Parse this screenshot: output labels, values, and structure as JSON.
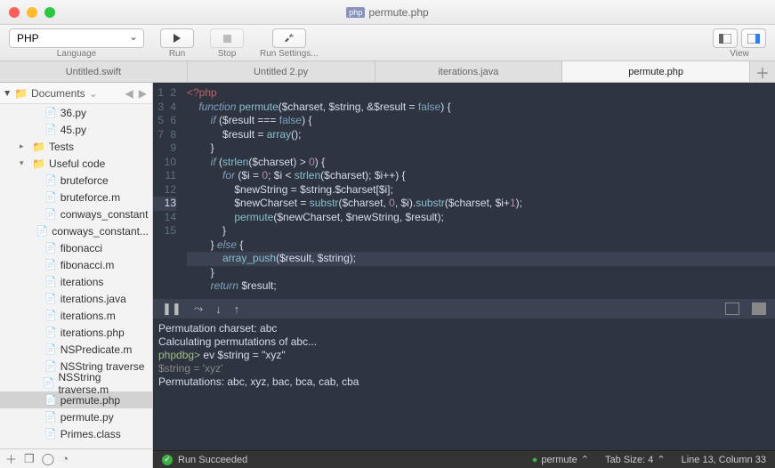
{
  "window": {
    "title": "permute.php"
  },
  "toolbar": {
    "language": {
      "value": "PHP",
      "label": "Language"
    },
    "run_label": "Run",
    "stop_label": "Stop",
    "run_settings_label": "Run Settings...",
    "view_label": "View"
  },
  "tabs": [
    {
      "label": "Untitled.swift"
    },
    {
      "label": "Untitled 2.py"
    },
    {
      "label": "iterations.java"
    },
    {
      "label": "permute.php",
      "active": true
    }
  ],
  "sidebar": {
    "root": "Documents",
    "items": [
      {
        "type": "file",
        "depth": 2,
        "name": "36.py"
      },
      {
        "type": "file",
        "depth": 2,
        "name": "45.py"
      },
      {
        "type": "folder",
        "depth": 1,
        "name": "Tests",
        "expanded": false
      },
      {
        "type": "folder",
        "depth": 1,
        "name": "Useful code",
        "expanded": true
      },
      {
        "type": "file",
        "depth": 2,
        "name": "bruteforce"
      },
      {
        "type": "file",
        "depth": 2,
        "name": "bruteforce.m"
      },
      {
        "type": "file",
        "depth": 2,
        "name": "conways_constant"
      },
      {
        "type": "file",
        "depth": 2,
        "name": "conways_constant..."
      },
      {
        "type": "file",
        "depth": 2,
        "name": "fibonacci"
      },
      {
        "type": "file",
        "depth": 2,
        "name": "fibonacci.m"
      },
      {
        "type": "file",
        "depth": 2,
        "name": "iterations"
      },
      {
        "type": "file",
        "depth": 2,
        "name": "iterations.java"
      },
      {
        "type": "file",
        "depth": 2,
        "name": "iterations.m"
      },
      {
        "type": "file",
        "depth": 2,
        "name": "iterations.php"
      },
      {
        "type": "file",
        "depth": 2,
        "name": "NSPredicate.m"
      },
      {
        "type": "file",
        "depth": 2,
        "name": "NSString traverse"
      },
      {
        "type": "file",
        "depth": 2,
        "name": "NSString traverse.m"
      },
      {
        "type": "file",
        "depth": 2,
        "name": "permute.php",
        "selected": true
      },
      {
        "type": "file",
        "depth": 2,
        "name": "permute.py"
      },
      {
        "type": "file",
        "depth": 2,
        "name": "Primes.class"
      }
    ]
  },
  "code": {
    "current_line": 13,
    "lines": [
      "<?php",
      "    function permute($charset, $string, &$result = false) {",
      "        if ($result === false) {",
      "            $result = array();",
      "        }",
      "        if (strlen($charset) > 0) {",
      "            for ($i = 0; $i < strlen($charset); $i++) {",
      "                $newString = $string.$charset[$i];",
      "                $newCharset = substr($charset, 0, $i).substr($charset, $i+1);",
      "                permute($newCharset, $newString, $result);",
      "            }",
      "        } else {",
      "            array_push($result, $string);",
      "        }",
      "        return $result;"
    ]
  },
  "console": {
    "lines": [
      "Permutation charset: abc",
      "Calculating permutations of abc...",
      "phpdbg> ev $string = \"xyz\"",
      "$string = 'xyz'",
      "Permutations: abc, xyz, bac, bca, cab, cba"
    ]
  },
  "status": {
    "run": "Run Succeeded",
    "branch": "permute",
    "tab_size": "Tab Size: 4",
    "cursor": "Line 13, Column 33"
  }
}
